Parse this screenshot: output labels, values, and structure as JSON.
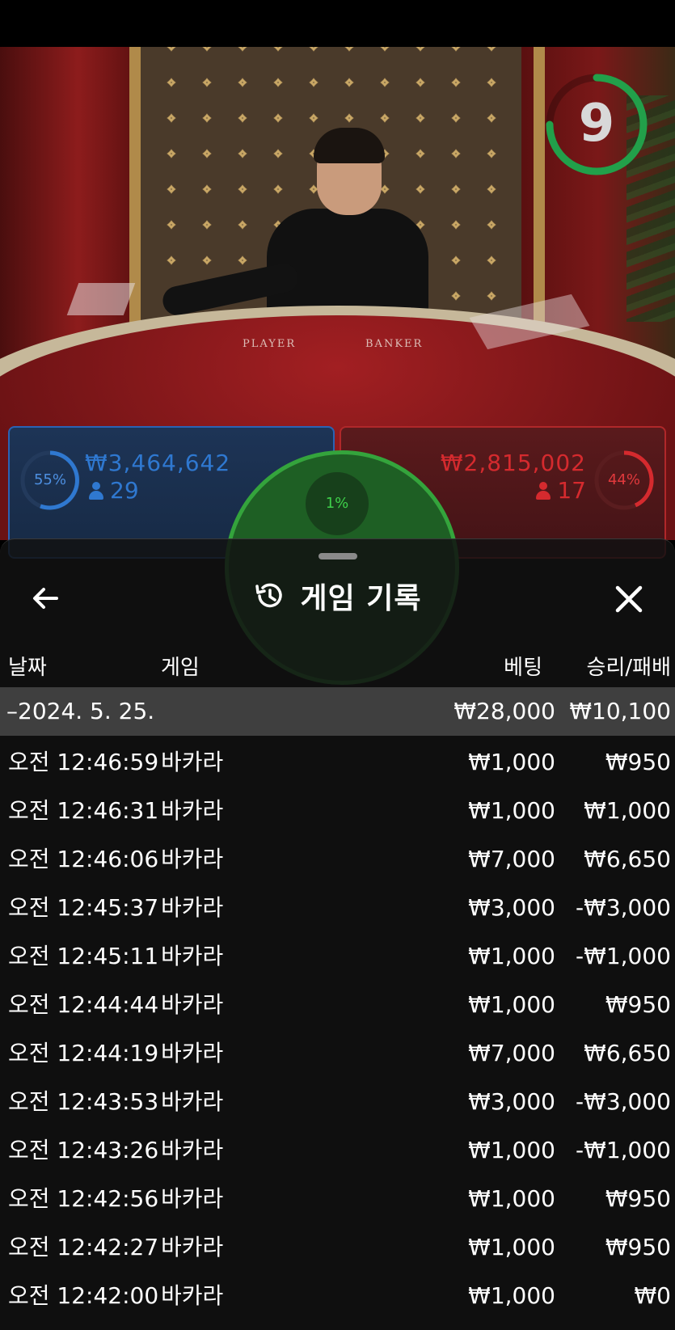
{
  "video": {
    "felt_player_label": "PLAYER",
    "felt_banker_label": "BANKER",
    "timer_value": "9"
  },
  "bets": {
    "player": {
      "percent": "55%",
      "amount": "₩3,464,642",
      "count": "29",
      "color": "#2f78d0"
    },
    "tie": {
      "percent": "1%",
      "color": "#3ed04a"
    },
    "banker": {
      "percent": "44%",
      "amount": "₩2,815,002",
      "count": "17",
      "color": "#d52a2e"
    }
  },
  "history": {
    "title": "게임 기록",
    "icons": {
      "back": "arrow-left-icon",
      "history": "history-clock-icon",
      "close": "close-icon"
    },
    "columns": {
      "date": "날짜",
      "game": "게임",
      "bet": "베팅",
      "win_loss": "승리/패배"
    },
    "summary": {
      "date": "–2024. 5. 25.",
      "bet": "₩28,000",
      "win_loss": "₩10,100"
    },
    "rows": [
      {
        "time": "오전 12:46:59",
        "game": "바카라",
        "bet": "₩1,000",
        "win_loss": "₩950"
      },
      {
        "time": "오전 12:46:31",
        "game": "바카라",
        "bet": "₩1,000",
        "win_loss": "₩1,000"
      },
      {
        "time": "오전 12:46:06",
        "game": "바카라",
        "bet": "₩7,000",
        "win_loss": "₩6,650"
      },
      {
        "time": "오전 12:45:37",
        "game": "바카라",
        "bet": "₩3,000",
        "win_loss": "-₩3,000"
      },
      {
        "time": "오전 12:45:11",
        "game": "바카라",
        "bet": "₩1,000",
        "win_loss": "-₩1,000"
      },
      {
        "time": "오전 12:44:44",
        "game": "바카라",
        "bet": "₩1,000",
        "win_loss": "₩950"
      },
      {
        "time": "오전 12:44:19",
        "game": "바카라",
        "bet": "₩7,000",
        "win_loss": "₩6,650"
      },
      {
        "time": "오전 12:43:53",
        "game": "바카라",
        "bet": "₩3,000",
        "win_loss": "-₩3,000"
      },
      {
        "time": "오전 12:43:26",
        "game": "바카라",
        "bet": "₩1,000",
        "win_loss": "-₩1,000"
      },
      {
        "time": "오전 12:42:56",
        "game": "바카라",
        "bet": "₩1,000",
        "win_loss": "₩950"
      },
      {
        "time": "오전 12:42:27",
        "game": "바카라",
        "bet": "₩1,000",
        "win_loss": "₩950"
      },
      {
        "time": "오전 12:42:00",
        "game": "바카라",
        "bet": "₩1,000",
        "win_loss": "₩0"
      }
    ]
  }
}
